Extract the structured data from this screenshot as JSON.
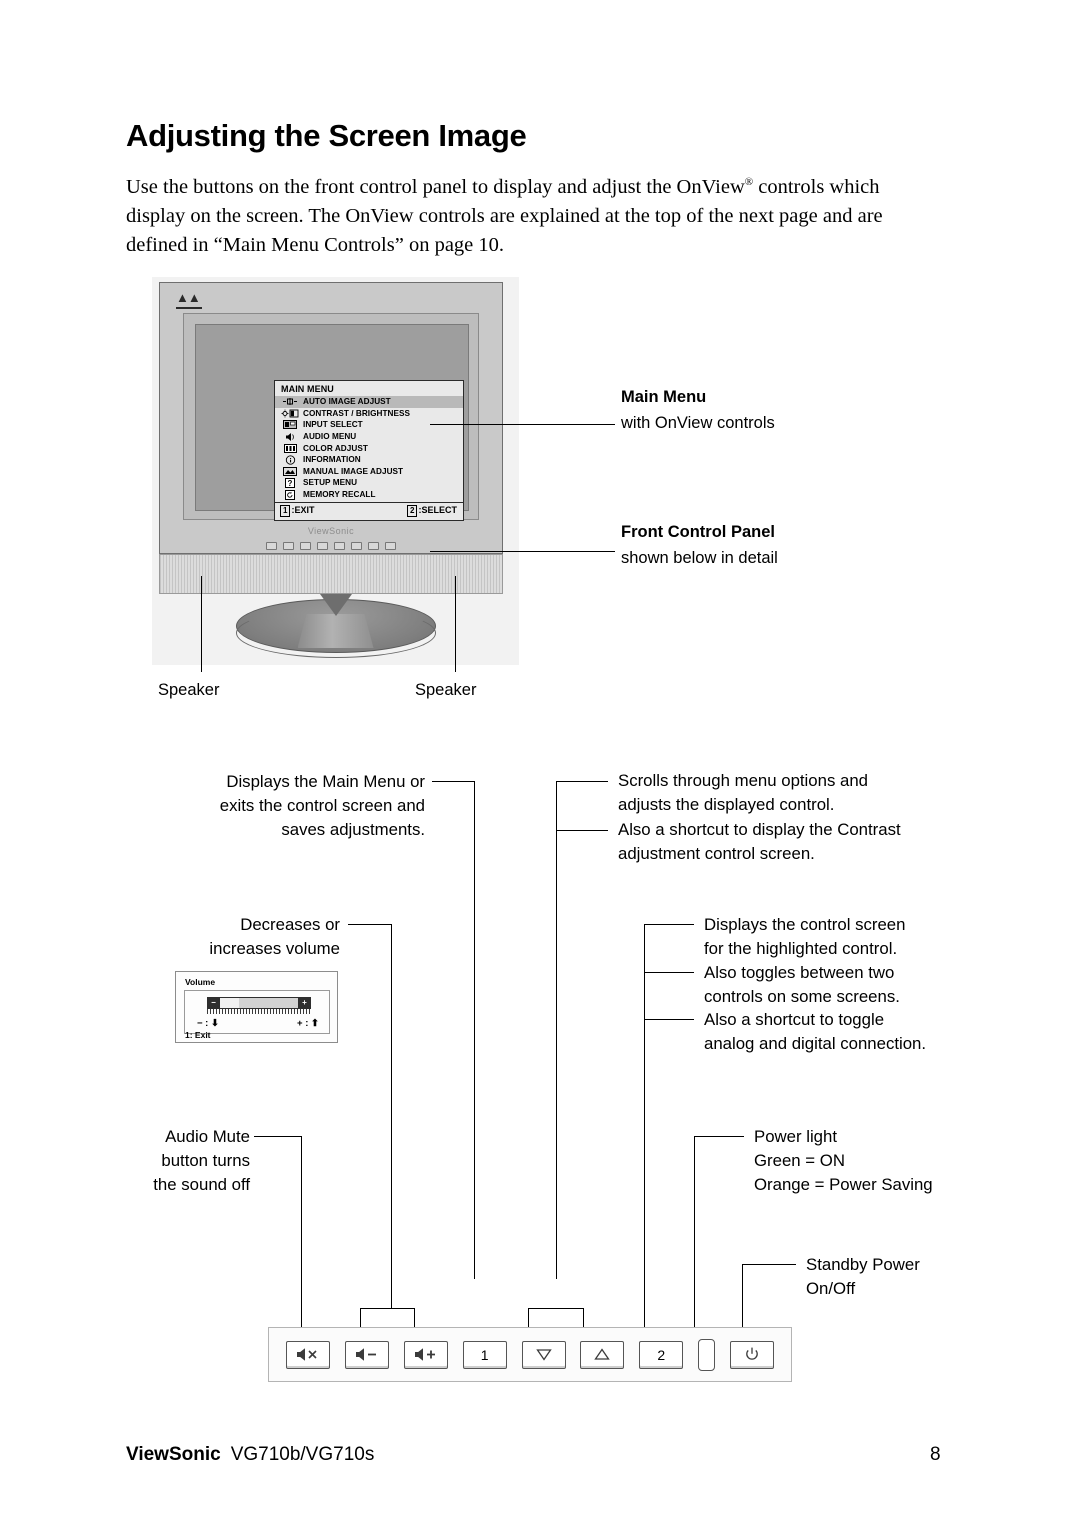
{
  "document": {
    "title": "Adjusting the Screen Image",
    "intro_part1": "Use the buttons on the front control panel to display and adjust the OnView",
    "intro_sup": "®",
    "intro_part2": " controls which display on the screen. The OnView controls are explained at the top of the next page and are defined in “Main Menu Controls” on page 10."
  },
  "osd_menu": {
    "title": "MAIN MENU",
    "items": [
      {
        "label": "AUTO IMAGE ADJUST",
        "icon": "crosshair-icon",
        "highlighted": true
      },
      {
        "label": "CONTRAST / BRIGHTNESS",
        "icon": "sun-contrast-icon",
        "highlighted": false
      },
      {
        "label": "INPUT SELECT",
        "icon": "input-select-icon",
        "highlighted": false
      },
      {
        "label": "AUDIO MENU",
        "icon": "speaker-icon",
        "highlighted": false
      },
      {
        "label": "COLOR ADJUST",
        "icon": "color-bars-icon",
        "highlighted": false
      },
      {
        "label": "INFORMATION",
        "icon": "info-icon",
        "highlighted": false
      },
      {
        "label": "MANUAL IMAGE ADJUST",
        "icon": "image-adjust-icon",
        "highlighted": false
      },
      {
        "label": "SETUP MENU",
        "icon": "question-icon",
        "highlighted": false
      },
      {
        "label": "MEMORY RECALL",
        "icon": "memory-recall-icon",
        "highlighted": false
      }
    ],
    "footer": {
      "exit_key": "1",
      "exit_label": ":EXIT",
      "select_key": "2",
      "select_label": ":SELECT"
    }
  },
  "monitor": {
    "brand_wordmark": "ViewSonic"
  },
  "callouts": {
    "main_menu_title": "Main Menu",
    "main_menu_sub": "with OnView controls",
    "front_panel_title": "Front Control Panel",
    "front_panel_sub": "shown below in detail",
    "speaker_left": "Speaker",
    "speaker_right": "Speaker",
    "button1": "Displays the Main Menu or\nexits the control screen and\nsaves adjustments.",
    "volume": "Decreases or\nincreases volume",
    "audio_mute": "Audio Mute\nbutton turns\nthe sound off",
    "arrows_1": "Scrolls through menu options and\nadjusts the displayed control.",
    "arrows_2": "Also a shortcut to display the Contrast\nadjustment control screen.",
    "button2_1": "Displays the control screen\nfor the highlighted control.",
    "button2_2": "Also toggles between two\ncontrols on some screens.",
    "button2_3": "Also a shortcut to toggle\nanalog and digital connection.",
    "power_light": "Power light\nGreen = ON\nOrange = Power Saving",
    "standby": "Standby Power\nOn/Off"
  },
  "volume_osd": {
    "title": "Volume",
    "minus_glyph": "−",
    "plus_glyph": "+",
    "hint_left": "− :",
    "hint_right": "+ :",
    "exit": "1: Exit"
  },
  "control_panel": {
    "buttons": [
      {
        "name": "audio-mute-button",
        "icon": "speaker-mute-icon",
        "label": ""
      },
      {
        "name": "volume-down-button",
        "icon": "speaker-minus-icon",
        "label": ""
      },
      {
        "name": "volume-up-button",
        "icon": "speaker-plus-icon",
        "label": ""
      },
      {
        "name": "menu-button-1",
        "icon": "digit-icon",
        "label": "1"
      },
      {
        "name": "scroll-down-button",
        "icon": "triangle-down-icon",
        "label": ""
      },
      {
        "name": "scroll-up-button",
        "icon": "triangle-up-icon",
        "label": ""
      },
      {
        "name": "select-button-2",
        "icon": "digit-icon",
        "label": "2"
      },
      {
        "name": "power-led",
        "icon": "led-indicator-icon",
        "label": ""
      },
      {
        "name": "power-button",
        "icon": "power-icon",
        "label": ""
      }
    ]
  },
  "footer": {
    "brand": "ViewSonic",
    "model": "VG710b/VG710s",
    "page_number": "8"
  }
}
